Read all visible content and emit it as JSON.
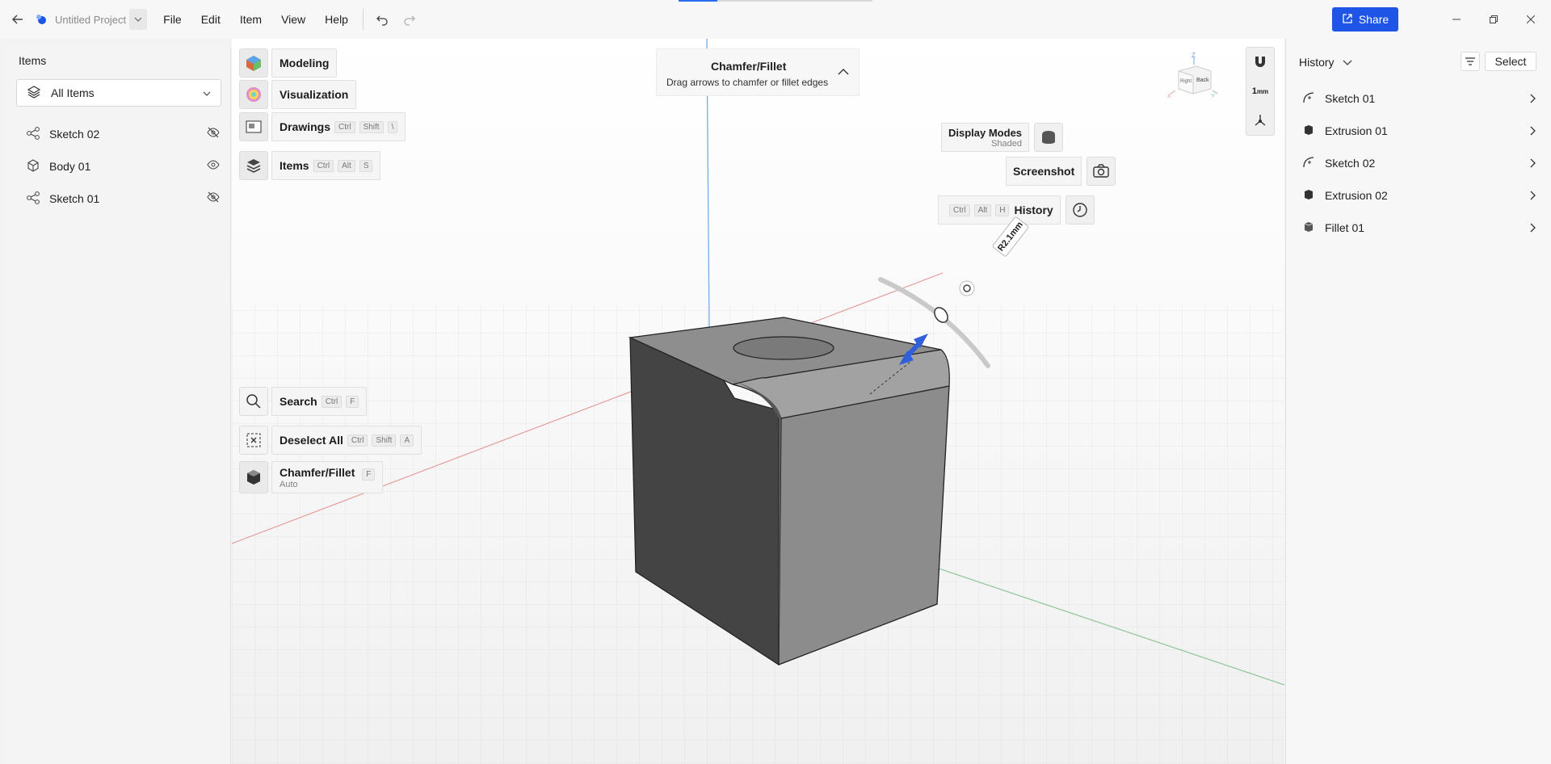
{
  "app": {
    "project_name": "Untitled Project",
    "menu": [
      "File",
      "Edit",
      "Item",
      "View",
      "Help"
    ],
    "share_label": "Share",
    "icons": [
      "back-arrow-icon",
      "app-logo-icon",
      "undo-icon",
      "redo-icon",
      "minimize-icon",
      "restore-icon",
      "close-icon"
    ]
  },
  "items_panel": {
    "title": "Items",
    "filter_value": "All Items",
    "items": [
      {
        "name": "Sketch 02",
        "icon": "sketch-icon",
        "visible": false
      },
      {
        "name": "Body 01",
        "icon": "body-cube-icon",
        "visible": true
      },
      {
        "name": "Sketch 01",
        "icon": "sketch-icon",
        "visible": false
      }
    ]
  },
  "tools": {
    "modeling": {
      "label": "Modeling"
    },
    "visualization": {
      "label": "Visualization"
    },
    "drawings": {
      "label": "Drawings",
      "keys": [
        "Ctrl",
        "Shift",
        "\\"
      ]
    },
    "items": {
      "label": "Items",
      "keys": [
        "Ctrl",
        "Alt",
        "S"
      ]
    },
    "search": {
      "label": "Search",
      "keys": [
        "Ctrl",
        "F"
      ]
    },
    "deselect": {
      "label": "Deselect All",
      "keys": [
        "Ctrl",
        "Shift",
        "A"
      ]
    },
    "chamfer": {
      "label": "Chamfer/Fillet",
      "key": "F",
      "mode": "Auto"
    }
  },
  "chamfer_hint": {
    "title": "Chamfer/Fillet",
    "subtitle": "Drag arrows to chamfer or fillet edges"
  },
  "viewport_controls": {
    "display_modes": {
      "label": "Display Modes",
      "value": "Shaded"
    },
    "screenshot": {
      "label": "Screenshot"
    },
    "history": {
      "label": "History",
      "keys": [
        "Ctrl",
        "Alt",
        "H"
      ]
    },
    "scale": {
      "value": "1",
      "unit": "mm"
    },
    "view_cube": {
      "face_front": "Right",
      "face_side": "Back",
      "axis_z": "Z",
      "axis_x": "X",
      "axis_y": "Y"
    }
  },
  "dimension": {
    "label": "R2.1mm"
  },
  "history_panel": {
    "title": "History",
    "select_label": "Select",
    "items": [
      {
        "name": "Sketch 01",
        "icon": "sketch-icon"
      },
      {
        "name": "Extrusion 01",
        "icon": "extrusion-icon"
      },
      {
        "name": "Sketch 02",
        "icon": "sketch-icon"
      },
      {
        "name": "Extrusion 02",
        "icon": "extrusion-icon"
      },
      {
        "name": "Fillet 01",
        "icon": "fillet-icon"
      }
    ]
  },
  "colors": {
    "accent": "#1f55e6",
    "x_axis": "#e06666",
    "y_axis": "#6aa84f",
    "z_axis": "#4a90e2"
  }
}
